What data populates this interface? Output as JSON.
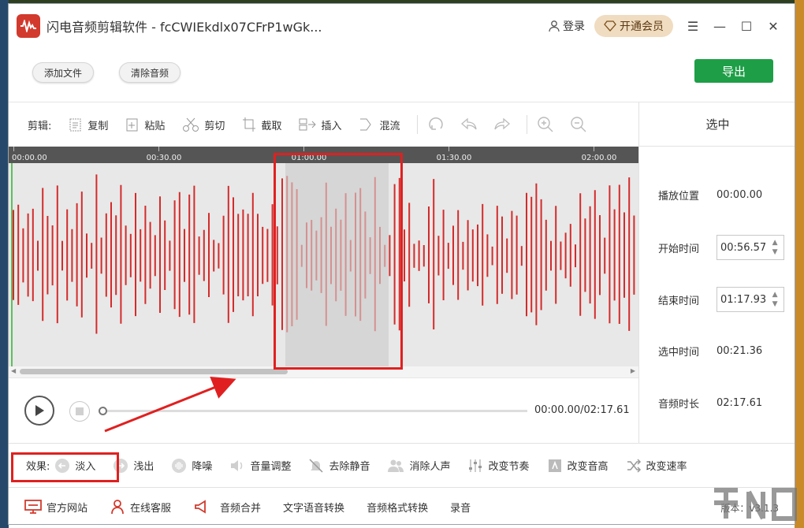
{
  "app": {
    "title": "闪电音频剪辑软件 - fcCWIEkdlx07CFrP1wGk...",
    "login_label": "登录",
    "vip_label": "开通会员"
  },
  "toolbar": {
    "add_file": "添加文件",
    "clear_audio": "清除音频",
    "export": "导出"
  },
  "edit": {
    "label": "剪辑:",
    "copy": "复制",
    "paste": "粘贴",
    "cut": "剪切",
    "crop": "截取",
    "insert": "插入",
    "mix": "混流"
  },
  "timeline": {
    "ticks": [
      "00:00.00",
      "00:30.00",
      "01:00.00",
      "01:30.00",
      "02:00.00"
    ]
  },
  "selection_panel": {
    "title": "选中",
    "play_position_label": "播放位置",
    "play_position": "00:00.00",
    "start_label": "开始时间",
    "start": "00:56.57",
    "end_label": "结束时间",
    "end": "01:17.93",
    "selected_label": "选中时间",
    "selected": "00:21.36",
    "duration_label": "音频时长",
    "duration": "02:17.61"
  },
  "player": {
    "time_readout": "00:00.00/02:17.61"
  },
  "effects": {
    "label": "效果:",
    "fade_in": "淡入",
    "fade_out": "浅出",
    "denoise": "降噪",
    "volume": "音量调整",
    "remove_silence": "去除静音",
    "remove_vocal": "消除人声",
    "tempo": "改变节奏",
    "pitch": "改变音高",
    "speed": "改变速率"
  },
  "bottom": {
    "website": "官方网站",
    "support": "在线客服",
    "merge": "音频合并",
    "tts": "文字语音转换",
    "format": "音频格式转换",
    "record": "录音",
    "version": "版本：v3.1.3"
  },
  "colors": {
    "waveform": "#d42b2b",
    "export_button": "#1e9e47",
    "annotation": "#e02020"
  }
}
